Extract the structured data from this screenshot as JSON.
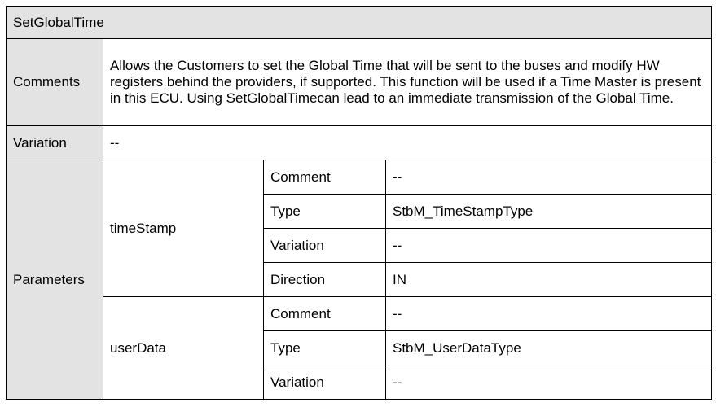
{
  "title": "SetGlobalTime",
  "comments": {
    "label": "Comments",
    "text": "Allows the Customers to set the Global Time that will be sent to the buses and modify HW registers behind the providers, if supported. This function will be used if a Time Master is present in this ECU. Using SetGlobalTimecan lead to an immediate transmission of the Global Time."
  },
  "variation": {
    "label": "Variation",
    "value": "--"
  },
  "parameters": {
    "label": "Parameters",
    "items": [
      {
        "name": "timeStamp",
        "rows": [
          {
            "key": "Comment",
            "value": "--"
          },
          {
            "key": "Type",
            "value": "StbM_TimeStampType"
          },
          {
            "key": "Variation",
            "value": "--"
          },
          {
            "key": "Direction",
            "value": "IN"
          }
        ]
      },
      {
        "name": "userData",
        "rows": [
          {
            "key": "Comment",
            "value": "--"
          },
          {
            "key": "Type",
            "value": "StbM_UserDataType"
          },
          {
            "key": "Variation",
            "value": "--"
          }
        ]
      }
    ]
  }
}
